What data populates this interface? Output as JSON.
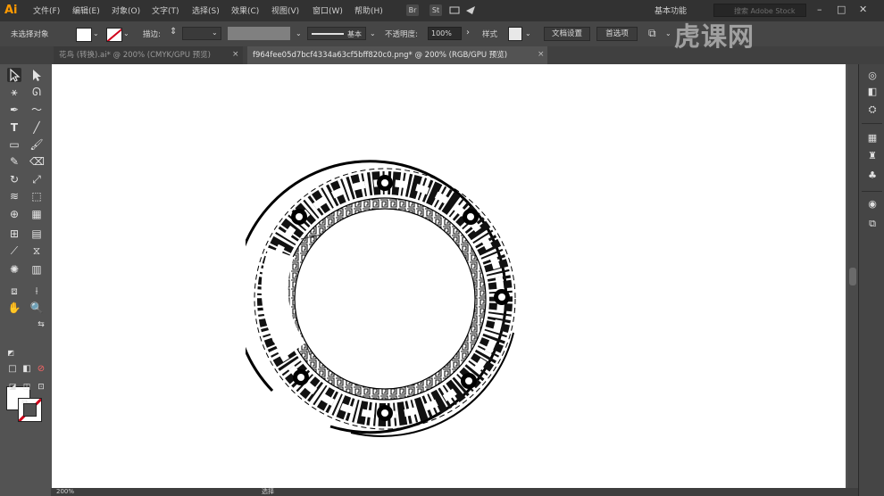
{
  "app": {
    "logo": "Ai"
  },
  "menu": {
    "items": [
      "文件(F)",
      "编辑(E)",
      "对象(O)",
      "文字(T)",
      "选择(S)",
      "效果(C)",
      "视图(V)",
      "窗口(W)",
      "帮助(H)"
    ],
    "bridge_icon": "Br",
    "stock_icon": "St",
    "workspace": "基本功能",
    "search_placeholder": "搜索 Adobe Stock"
  },
  "control_bar": {
    "selection_label": "未选择对象",
    "stroke_label": "描边:",
    "stroke_weight": "",
    "brush_label": "基本",
    "opacity_label": "不透明度:",
    "opacity_value": "100%",
    "style_label": "样式",
    "doc_setup": "文档设置",
    "preferences": "首选项"
  },
  "tabs": [
    {
      "label": "花鸟 (转换).ai* @ 200% (CMYK/GPU 预览)",
      "active": false
    },
    {
      "label": "f964fee05d7bcf4334a63cf5bff820c0.png* @ 200% (RGB/GPU 预览)",
      "active": true
    }
  ],
  "status": {
    "zoom": "200%",
    "tool": "选择"
  },
  "watermark": "虎课网",
  "colors": {
    "accent": "#ff9a00",
    "none_slash": "#d0021b",
    "canvas": "#535353",
    "artboard": "#ffffff"
  }
}
